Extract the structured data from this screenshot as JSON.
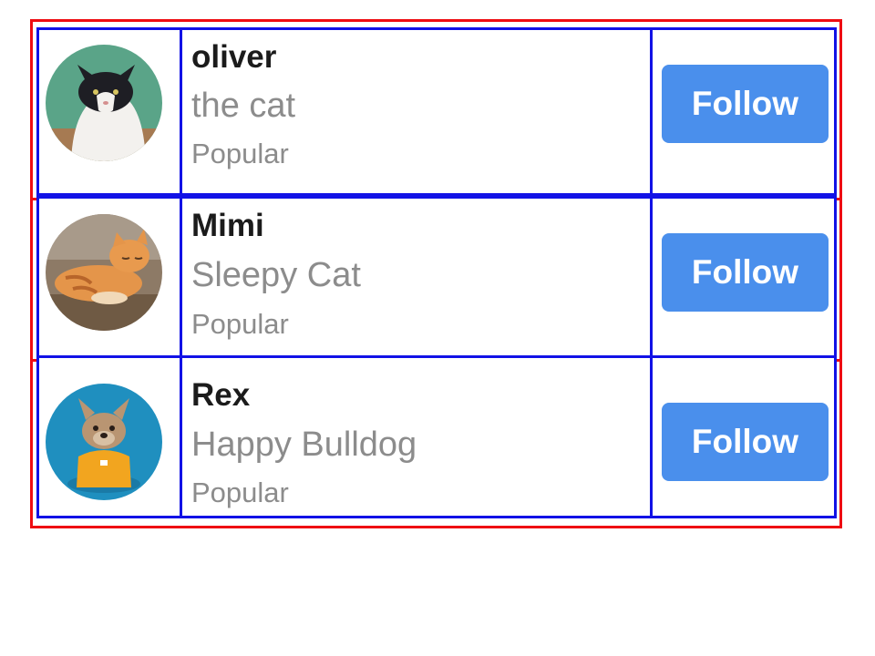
{
  "users": [
    {
      "name": "oliver",
      "subtitle": "the cat",
      "tag": "Popular",
      "button": "Follow",
      "avatar": "tuxedo-cat-avatar"
    },
    {
      "name": "Mimi",
      "subtitle": "Sleepy Cat",
      "tag": "Popular",
      "button": "Follow",
      "avatar": "orange-tabby-cat-avatar"
    },
    {
      "name": "Rex",
      "subtitle": "Happy Bulldog",
      "tag": "Popular",
      "button": "Follow",
      "avatar": "french-bulldog-avatar"
    }
  ],
  "colors": {
    "outer_border": "#ee0c12",
    "card_border": "#1212e6",
    "button": "#4a8fec",
    "muted_text": "#8c8c8c"
  }
}
